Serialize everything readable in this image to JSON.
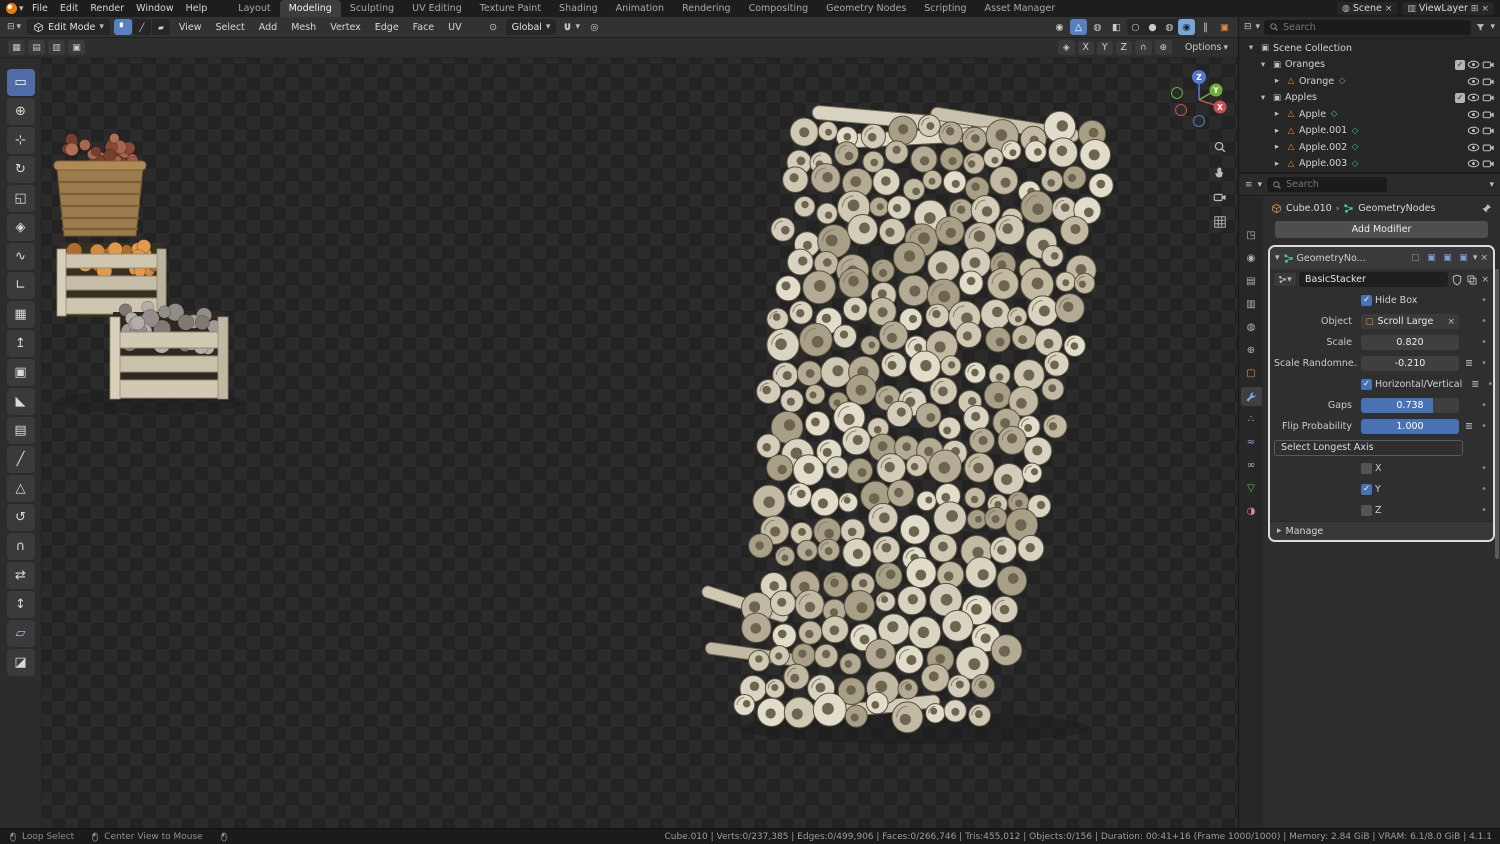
{
  "topbar": {
    "menus": [
      "File",
      "Edit",
      "Render",
      "Window",
      "Help"
    ],
    "workspaces": [
      "Layout",
      "Modeling",
      "Sculpting",
      "UV Editing",
      "Texture Paint",
      "Shading",
      "Animation",
      "Rendering",
      "Compositing",
      "Geometry Nodes",
      "Scripting",
      "Asset Manager"
    ],
    "scene_label": "Scene",
    "viewlayer_label": "ViewLayer"
  },
  "vph": {
    "mode": "Edit Mode",
    "menus": [
      "View",
      "Select",
      "Add",
      "Mesh",
      "Vertex",
      "Edge",
      "Face",
      "UV"
    ],
    "orientation": "Global",
    "options_label": "Options",
    "mirror": [
      "X",
      "Y",
      "Z"
    ]
  },
  "outliner": {
    "search_placeholder": "Search",
    "rows": [
      {
        "label": "Scene Collection"
      },
      {
        "label": "Oranges"
      },
      {
        "label": "Orange"
      },
      {
        "label": "Apples"
      },
      {
        "label": "Apple"
      },
      {
        "label": "Apple.001"
      },
      {
        "label": "Apple.002"
      },
      {
        "label": "Apple.003"
      }
    ]
  },
  "props": {
    "search_placeholder": "Search",
    "object": "Cube.010",
    "modifier_bc": "GeometryNodes",
    "add_modifier": "Add Modifier",
    "mod": {
      "name": "GeometryNo...",
      "node_group": "BasicStacker",
      "hide_box": "Hide Box",
      "object_label": "Object",
      "object_value": "Scroll Large",
      "scale_label": "Scale",
      "scale_value": "0.820",
      "scale_rand_label": "Scale Randomne...",
      "scale_rand_value": "-0.210",
      "hv_label": "Horizontal/Vertical",
      "gaps_label": "Gaps",
      "gaps_value": "0.738",
      "gaps_fill": 0.738,
      "flip_label": "Flip Probability",
      "flip_value": "1.000",
      "flip_fill": 1,
      "axis_header": "Select Longest Axis",
      "axis_x": "X",
      "axis_y": "Y",
      "axis_z": "Z",
      "manage": "Manage"
    }
  },
  "status": {
    "hint1": "Loop Select",
    "hint2": "Center View to Mouse",
    "stats": "Cube.010 | Verts:0/237,385 | Edges:0/499,906 | Faces:0/266,746 | Tris:455,012 | Objects:0/156 | Duration: 00:41+16 (Frame 1000/1000) | Memory: 2.84 GiB | VRAM: 6.1/8.0 GiB | 4.1.1"
  },
  "gizmo": {
    "x": "X",
    "y": "Y",
    "z": "Z"
  },
  "colors": {
    "accent": "#4772b3",
    "checker_dark": "#232323",
    "checker_light": "#2b2b2b",
    "highlight": "#5680c2"
  },
  "icons": {
    "check": "✓",
    "close": "×",
    "chev_down": "▾",
    "chev_right": "▸",
    "dot": "•",
    "sep": "›",
    "plus": "+",
    "menu": "≡",
    "driver": "≣",
    "vertex_mode": "▘",
    "edge_mode": "╱",
    "face_mode": "▰",
    "collection": "▣",
    "mesh": "△",
    "nodes": "◇",
    "box": "▢",
    "pivot": "⊙",
    "prop_edit": "◎",
    "pause": "‖",
    "tog_off": "▢",
    "tog_on": "▣",
    "browse1": "⊞",
    "browse2": "⊟",
    "tools": {
      "select_box": "▭",
      "cursor": "⊕",
      "move": "⊹",
      "rotate": "↻",
      "scale": "◱",
      "transform": "◈",
      "annotate": "∿",
      "measure": "∟",
      "add_cube": "▦",
      "extrude": "↥",
      "inset": "▣",
      "bevel": "◣",
      "loop_cut": "▤",
      "knife": "╱",
      "poly_build": "△",
      "spin": "↺",
      "smooth": "∩",
      "edge_slide": "⇄",
      "shrink_fatten": "↕",
      "shear": "▱",
      "rip_region": "◪"
    },
    "tabs": {
      "tool": "◳",
      "render": "◉",
      "output": "▤",
      "view_layer": "▥",
      "scene": "◍",
      "world": "⊕",
      "object": "▢",
      "particles": "∴",
      "physics": "≈",
      "constraints": "∞",
      "data": "▽",
      "material": "◑"
    },
    "shading": {
      "wire": "○",
      "solid": "●",
      "material": "◍",
      "rendered": "◉"
    },
    "overlay": {
      "visibility": "◉",
      "gizmo": "△",
      "overlays": "◍",
      "xray": "◧"
    }
  }
}
